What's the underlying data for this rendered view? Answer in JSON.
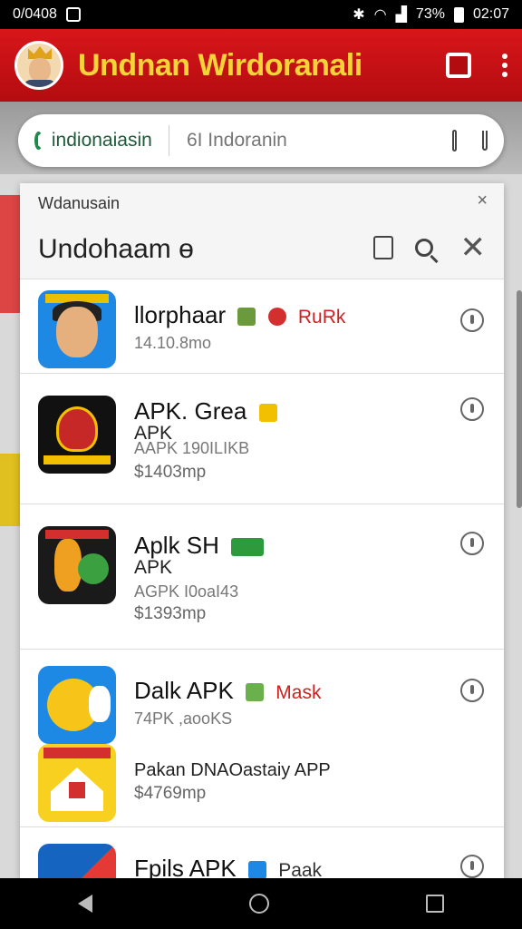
{
  "status_bar": {
    "time_left": "0/0408",
    "battery": "73%",
    "time_right": "02:07"
  },
  "app_bar": {
    "title": "Undnan Wirdoranali"
  },
  "search": {
    "brand": "indionaiasin",
    "placeholder": "6I Indoranin"
  },
  "card": {
    "subtitle": "Wdanusain",
    "close_small": "×",
    "title": "Undohaam ɵ",
    "close": "✕"
  },
  "apps": [
    {
      "name": "llorphaar",
      "tag": "RuRk",
      "meta": "14.10.8mo"
    },
    {
      "name": "APK. Grea",
      "subline": "APK",
      "meta": "AAPK 190ILIKB",
      "size": "$1403mp"
    },
    {
      "name": "Aplk SH",
      "subline": "APK",
      "meta": "AGPK I0oaI43",
      "size": "$1393mp"
    },
    {
      "name": "Dalk APK",
      "tag": "Mask",
      "meta": "74PK ,aooKS"
    },
    {
      "name": "Pakan DNAOastaiy APP",
      "size": "$4769mp"
    },
    {
      "name": "Fpils APK",
      "tag": "Paak"
    }
  ],
  "icons": [
    "wifi-icon",
    "signal-icon",
    "battery-icon",
    "app-logo-icon",
    "square-icon",
    "more-icon",
    "search-brand-icon",
    "bookmark-icon",
    "cart-icon",
    "doc-icon",
    "search-icon",
    "close-icon",
    "download-icon",
    "back-icon",
    "home-icon",
    "recents-icon"
  ],
  "colors": {
    "app_bar": "#d8161a",
    "title": "#f7d33a",
    "accent_red": "#c22"
  }
}
